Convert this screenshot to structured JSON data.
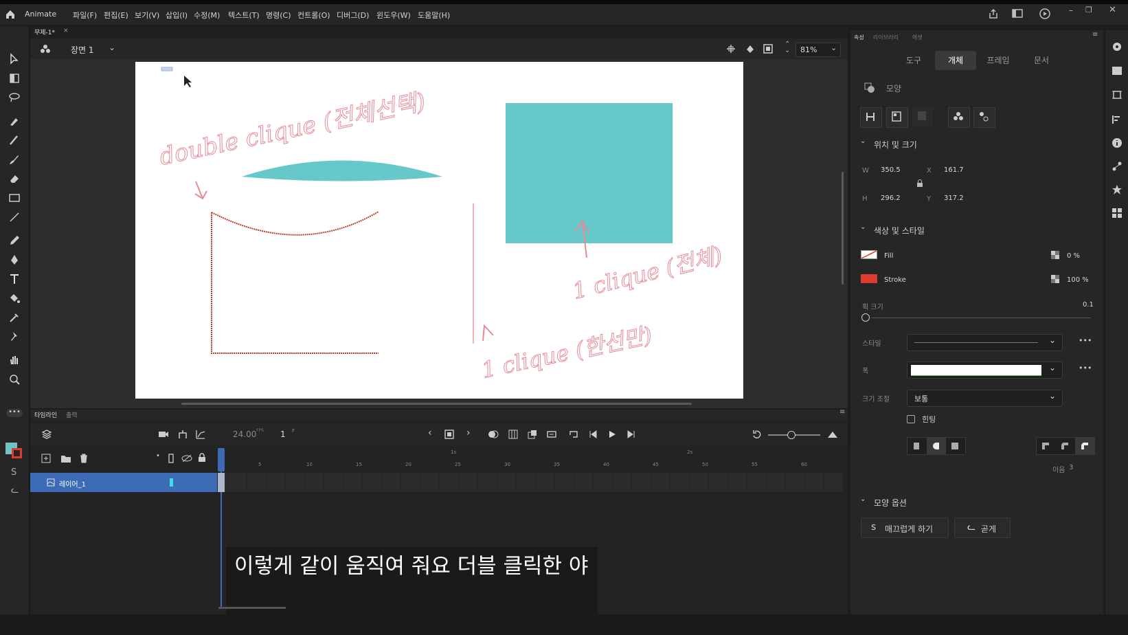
{
  "app": {
    "name": "Animate"
  },
  "menu": [
    "파일(F)",
    "편집(E)",
    "보기(V)",
    "삽입(I)",
    "수정(M)",
    "텍스트(T)",
    "명령(C)",
    "컨트롤(O)",
    "디버그(D)",
    "윈도우(W)",
    "도움말(H)"
  ],
  "document": {
    "tab_title": "무제-1*",
    "scene": "장면 1",
    "zoom": "81%"
  },
  "canvas_notes": {
    "note1": "double clique (전체선택)",
    "note2": "1 clique (전체)",
    "note3": "1 clique (한선만)"
  },
  "colors": {
    "shape_fill": "#66c8c8",
    "stroke_red": "#c0392b",
    "note_pink": "#e88a95",
    "accent": "#3d6bb5"
  },
  "timeline": {
    "label": "타임라인",
    "output_label": "출력",
    "fps": "24.00",
    "fps_unit": "FPS",
    "frame": "1",
    "frame_unit": "F",
    "sec_marks": [
      "1s",
      "2s"
    ],
    "ticks": [
      "5",
      "10",
      "15",
      "20",
      "25",
      "30",
      "35",
      "40",
      "45",
      "50",
      "55",
      "60"
    ],
    "layer_name": "레이어_1"
  },
  "panel": {
    "top_tabs": [
      "속성",
      "라이브러리",
      "에셋"
    ],
    "tabs": [
      "도구",
      "개체",
      "프레임",
      "문서"
    ],
    "active_tab": "개체",
    "object_type": "모양",
    "position_section": "위치 및 크기",
    "w_label": "W",
    "w": "350.5",
    "h_label": "H",
    "h": "296.2",
    "x_label": "X",
    "x": "161.7",
    "y_label": "Y",
    "y": "317.2",
    "color_section": "색상 및 스타일",
    "fill_label": "Fill",
    "fill_alpha": "0 %",
    "stroke_label": "Stroke",
    "stroke_alpha": "100 %",
    "stroke_size_label": "획 크기",
    "stroke_size": "0.1",
    "style_label": "스타일",
    "width_label": "폭",
    "scale_label": "크기 조절",
    "scale_value": "보통",
    "hinting_label": "힌팅",
    "miter_label": "이음",
    "miter_value": "3",
    "shape_options": "모양 옵션",
    "smooth_button": "매끄럽게 하기",
    "straighten_button": "곧게"
  },
  "subtitle": "이렇게 같이 움직여 줘요 더블 클릭한 야"
}
